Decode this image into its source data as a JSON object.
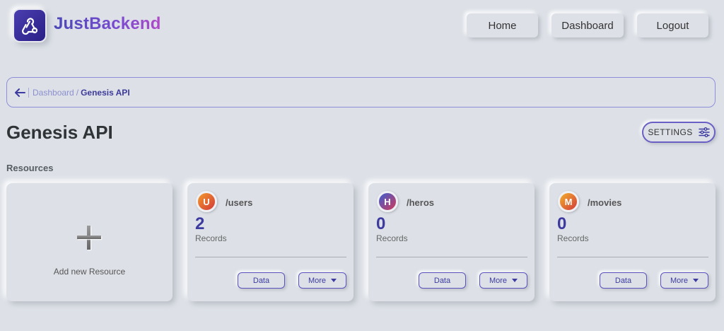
{
  "brand": {
    "name": "JustBackend",
    "logo_icon": "webhook-icon"
  },
  "nav": {
    "home": "Home",
    "dashboard": "Dashboard",
    "logout": "Logout"
  },
  "breadcrumb": {
    "back_icon": "arrow-left-icon",
    "parent": "Dashboard",
    "separator": "/",
    "current": "Genesis API"
  },
  "page": {
    "title": "Genesis API",
    "settings_label": "SETTINGS",
    "settings_icon": "sliders-icon",
    "section_label": "Resources"
  },
  "add_resource": {
    "icon": "plus-icon",
    "label": "Add new Resource"
  },
  "resources": [
    {
      "initial": "U",
      "name": "/users",
      "count": "2",
      "records_label": "Records",
      "data_label": "Data",
      "more_label": "More",
      "avatar_colors": [
        "#f39a2b",
        "#d23a3a"
      ]
    },
    {
      "initial": "H",
      "name": "/heros",
      "count": "0",
      "records_label": "Records",
      "data_label": "Data",
      "more_label": "More",
      "avatar_colors": [
        "#3a5fd0",
        "#d23a5a"
      ]
    },
    {
      "initial": "M",
      "name": "/movies",
      "count": "0",
      "records_label": "Records",
      "data_label": "Data",
      "more_label": "More",
      "avatar_colors": [
        "#f3b02b",
        "#d23a3a"
      ]
    }
  ],
  "colors": {
    "background": "#dde1e7",
    "accent": "#3d3aa0",
    "breadcrumb_border": "#8e8fd8"
  }
}
